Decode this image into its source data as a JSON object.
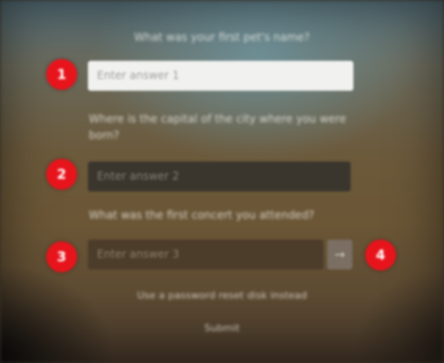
{
  "dialog": {
    "question_1": "What was your first pet's name?",
    "question_2": "Where is the capital of the city where you were born?",
    "question_3": "What was the first concert you attended?",
    "answer_1_placeholder": "Enter answer 1",
    "answer_2_placeholder": "Enter answer 2",
    "answer_3_placeholder": "Enter answer 3",
    "reset_link": "Use a password reset disk instead",
    "submit_label": "Submit"
  },
  "badges": [
    "1",
    "2",
    "3",
    "4"
  ],
  "icons": {
    "reveal": "eye-icon"
  },
  "colors": {
    "badge": "#e8141c",
    "field_active": "#f1f1ef",
    "field_dark": "#3a362d"
  }
}
